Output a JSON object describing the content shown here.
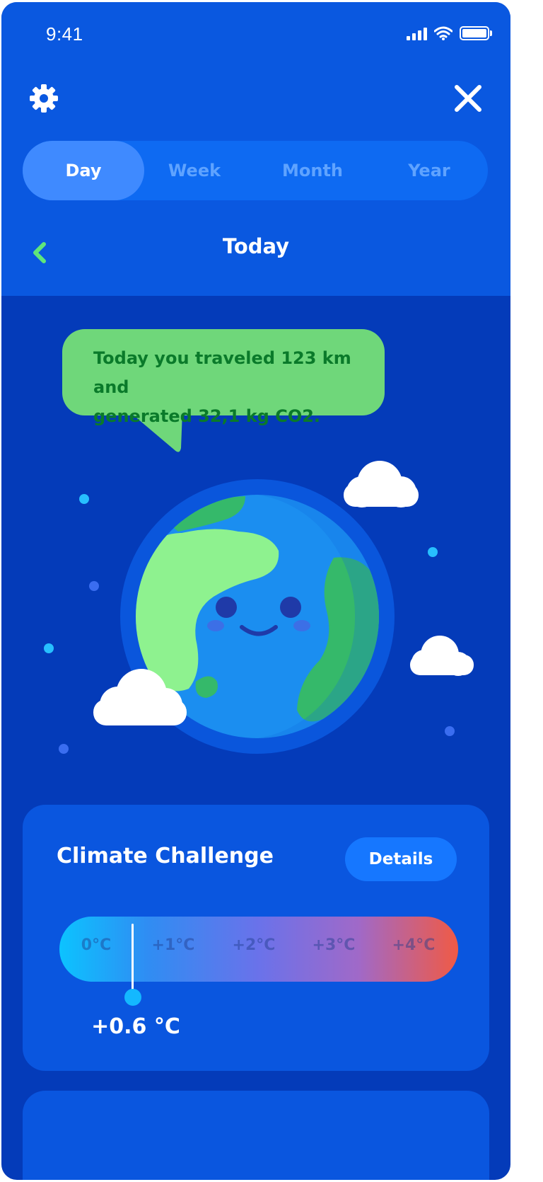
{
  "status_bar": {
    "time": "9:41"
  },
  "icons": {
    "settings": "gear-icon",
    "close": "close-icon",
    "back": "chevron-left-icon",
    "signal": "cellular-signal-icon",
    "wifi": "wifi-icon",
    "battery": "battery-icon"
  },
  "period_tabs": [
    {
      "label": "Day",
      "active": true
    },
    {
      "label": "Week",
      "active": false
    },
    {
      "label": "Month",
      "active": false
    },
    {
      "label": "Year",
      "active": false
    }
  ],
  "header": {
    "title": "Today"
  },
  "speech_bubble": {
    "line1": "Today you traveled 123 km and",
    "line2": "generated 32,1 kg CO2."
  },
  "climate_challenge": {
    "title": "Climate Challenge",
    "details_label": "Details",
    "scale_ticks": [
      "0°C",
      "+1°C",
      "+2°C",
      "+3°C",
      "+4°C"
    ],
    "current_value": 0.6,
    "current_label": "+0.6 °C",
    "scale_min": 0,
    "scale_max": 4
  },
  "colors": {
    "background": "#043bb9",
    "header": "#0a58e0",
    "bubble": "#6fd77a",
    "bubble_text": "#0a7a2a",
    "accent_green": "#5fe67a",
    "scale_cold": "#0cc3ff",
    "scale_hot": "#f05a45"
  }
}
